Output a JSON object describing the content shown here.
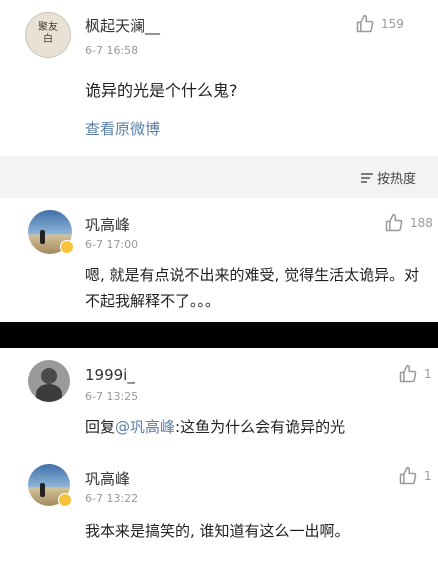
{
  "post": {
    "author": "枫起天澜__",
    "time": "6-7 16:58",
    "like_count": "159",
    "content": "诡异的光是个什么鬼?",
    "view_original": "查看原微博",
    "avatar_text": "聚友白"
  },
  "sort": {
    "label": "按热度"
  },
  "comments_top": [
    {
      "author": "巩高峰",
      "time": "6-7 17:00",
      "like_count": "188",
      "content": "嗯, 就是有点说不出来的难受, 觉得生活太诡异。对不起我解释不了。。。"
    }
  ],
  "comments_bottom": [
    {
      "author": "1999i_",
      "time": "6-7 13:25",
      "like_count": "1",
      "reply_prefix": "回复",
      "mention": "@巩高峰",
      "content": ":这鱼为什么会有诡异的光"
    },
    {
      "author": "巩高峰",
      "time": "6-7 13:22",
      "like_count": "1",
      "content": "我本来是搞笑的, 谁知道有这么一出啊。"
    }
  ]
}
